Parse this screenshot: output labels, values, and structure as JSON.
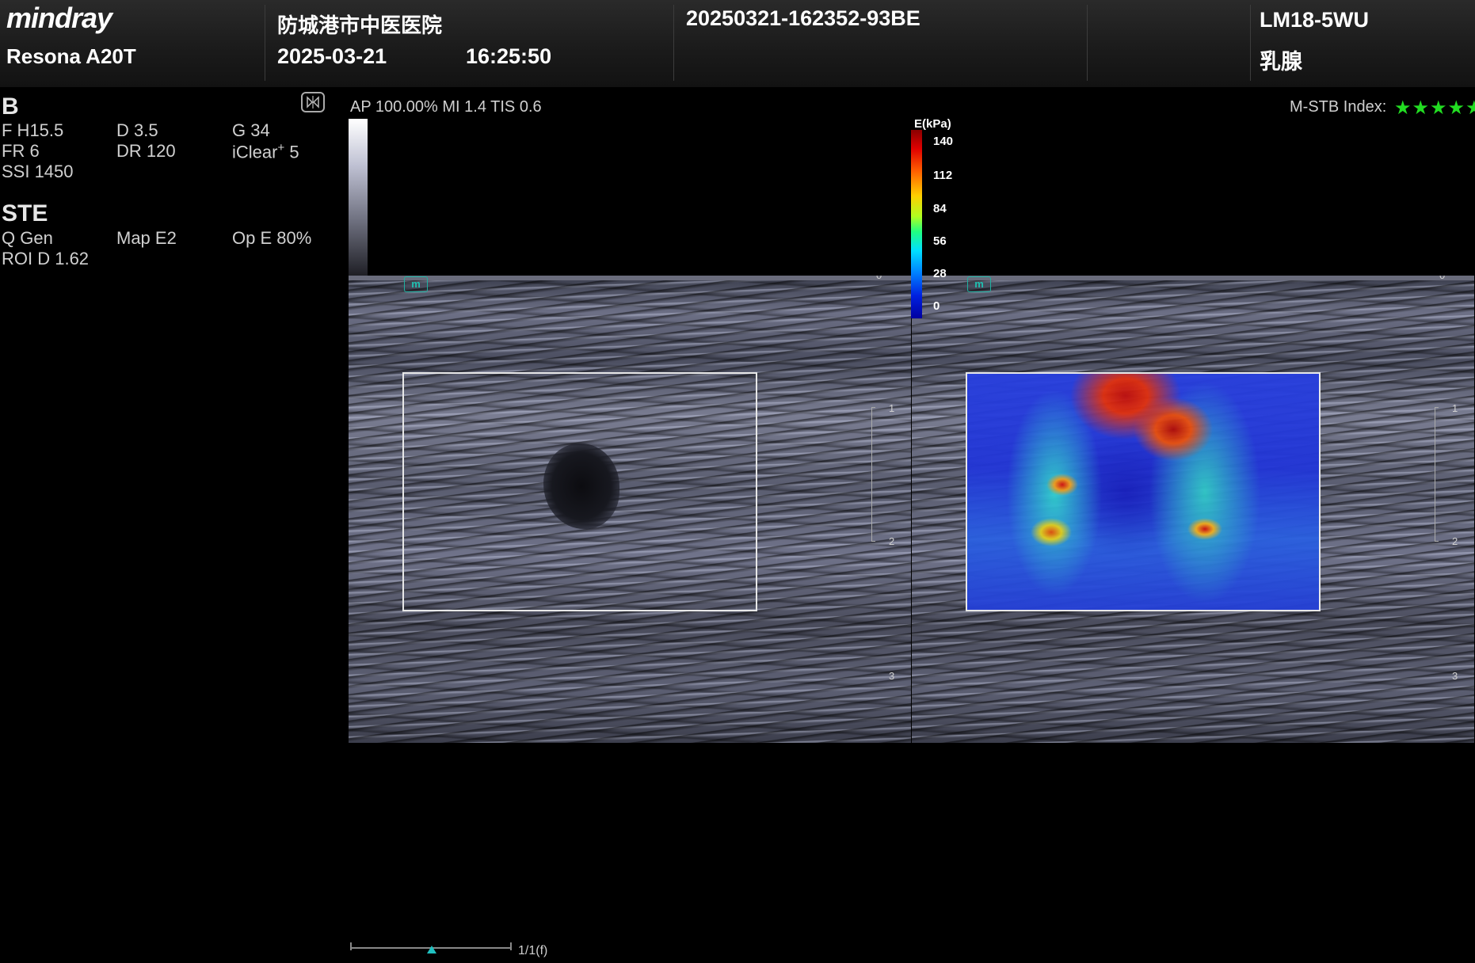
{
  "header": {
    "brand": "mindray",
    "model": "Resona A20T",
    "hospital": "防城港市中医医院",
    "date": "2025-03-21",
    "time": "16:25:50",
    "exam_id": "20250321-162352-93BE",
    "probe": "LM18-5WU",
    "preset": "乳腺"
  },
  "params": {
    "b_mode": "B",
    "b": [
      [
        "F H15.5",
        "D 3.5",
        "G 34"
      ],
      [
        "FR 6",
        "DR 120",
        "iClear"
      ],
      [
        "SSI 1450"
      ]
    ],
    "iclear_sup": "+",
    "iclear_val": "5",
    "ste_mode": "STE",
    "ste": [
      [
        "Q Gen",
        "Map E2",
        "Op E 80%"
      ],
      [
        "ROI D 1.62"
      ]
    ]
  },
  "status": {
    "acoustic": "AP 100.00%  MI 1.4 TIS 0.6",
    "mstb_label": "M-STB Index:",
    "mstb_stars": "★★★★★",
    "mstb_value": 5
  },
  "colorbar": {
    "title": "E(kPa)",
    "ticks": [
      "140",
      "112",
      "84",
      "56",
      "28",
      "0"
    ]
  },
  "depth_marks": [
    "0",
    "1",
    "2",
    "3"
  ],
  "orientation_mark": "m",
  "cine": {
    "frame_label": "1/1(f)"
  },
  "colors": {
    "stars": "#22dd22",
    "roi": "#e8e8e8",
    "orientation": "#1fc0b0"
  }
}
